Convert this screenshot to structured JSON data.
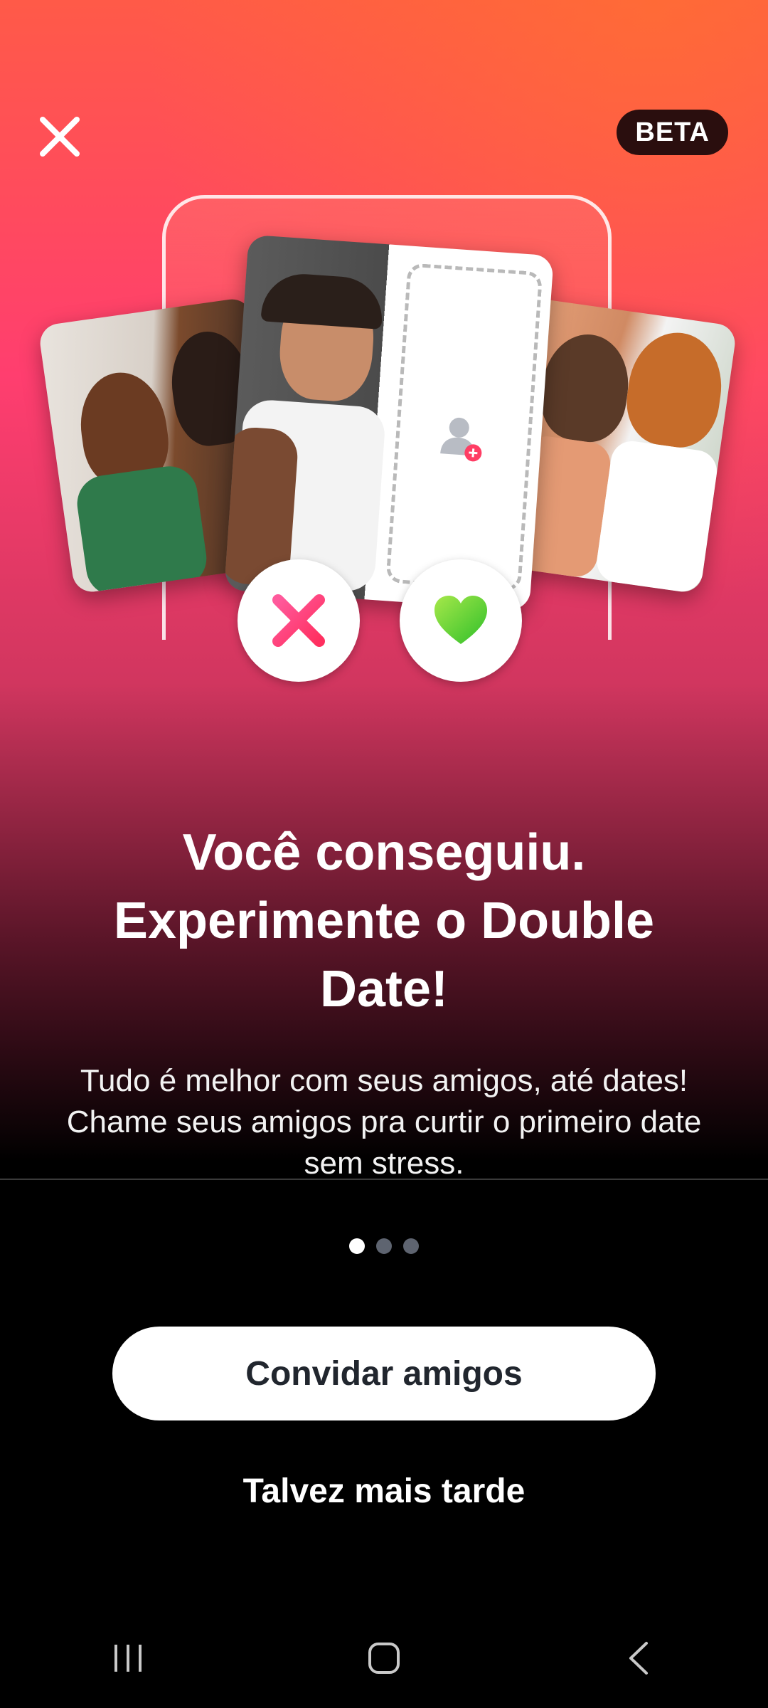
{
  "top_bar": {
    "close_icon": "close-icon",
    "badge": "BETA"
  },
  "hero": {
    "add_user_icon": "add-user-icon",
    "nope_icon": "x-icon",
    "like_icon": "heart-icon",
    "colors": {
      "nope": "#ff2f78",
      "like": "#4fcf2a"
    }
  },
  "content": {
    "title": "Você conseguiu. Experimente o Double Date!",
    "body": "Tudo é melhor com seus amigos, até dates! Chame seus amigos pra curtir o primeiro date sem stress."
  },
  "pager": {
    "count": 3,
    "active_index": 0
  },
  "actions": {
    "primary_label": "Convidar amigos",
    "secondary_label": "Talvez mais tarde"
  },
  "system_nav": {
    "recents_icon": "recents-icon",
    "home_icon": "home-icon",
    "back_icon": "back-icon"
  }
}
